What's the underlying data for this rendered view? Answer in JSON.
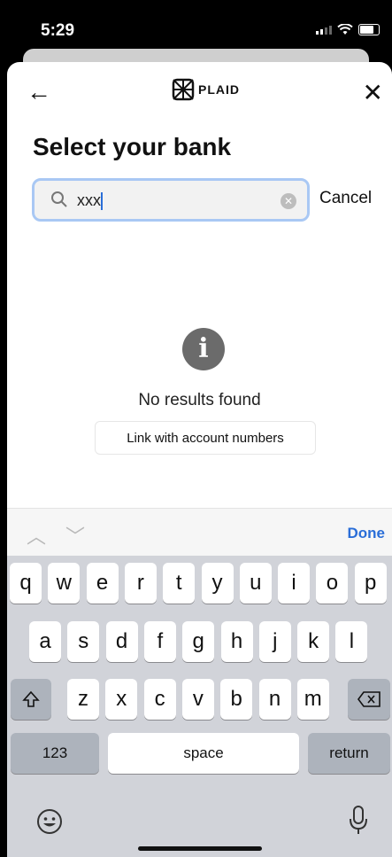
{
  "status": {
    "time": "5:29"
  },
  "header": {
    "logo_text": "PLAID"
  },
  "page": {
    "title": "Select your bank"
  },
  "search": {
    "value": "xxx",
    "cancel_label": "Cancel"
  },
  "empty_state": {
    "message": "No results found",
    "link_label": "Link with account numbers"
  },
  "keyboard": {
    "done_label": "Done",
    "row1": [
      "q",
      "w",
      "e",
      "r",
      "t",
      "y",
      "u",
      "i",
      "o",
      "p"
    ],
    "row2": [
      "a",
      "s",
      "d",
      "f",
      "g",
      "h",
      "j",
      "k",
      "l"
    ],
    "row3": [
      "z",
      "x",
      "c",
      "v",
      "b",
      "n",
      "m"
    ],
    "numbers_label": "123",
    "space_label": "space",
    "return_label": "return"
  }
}
